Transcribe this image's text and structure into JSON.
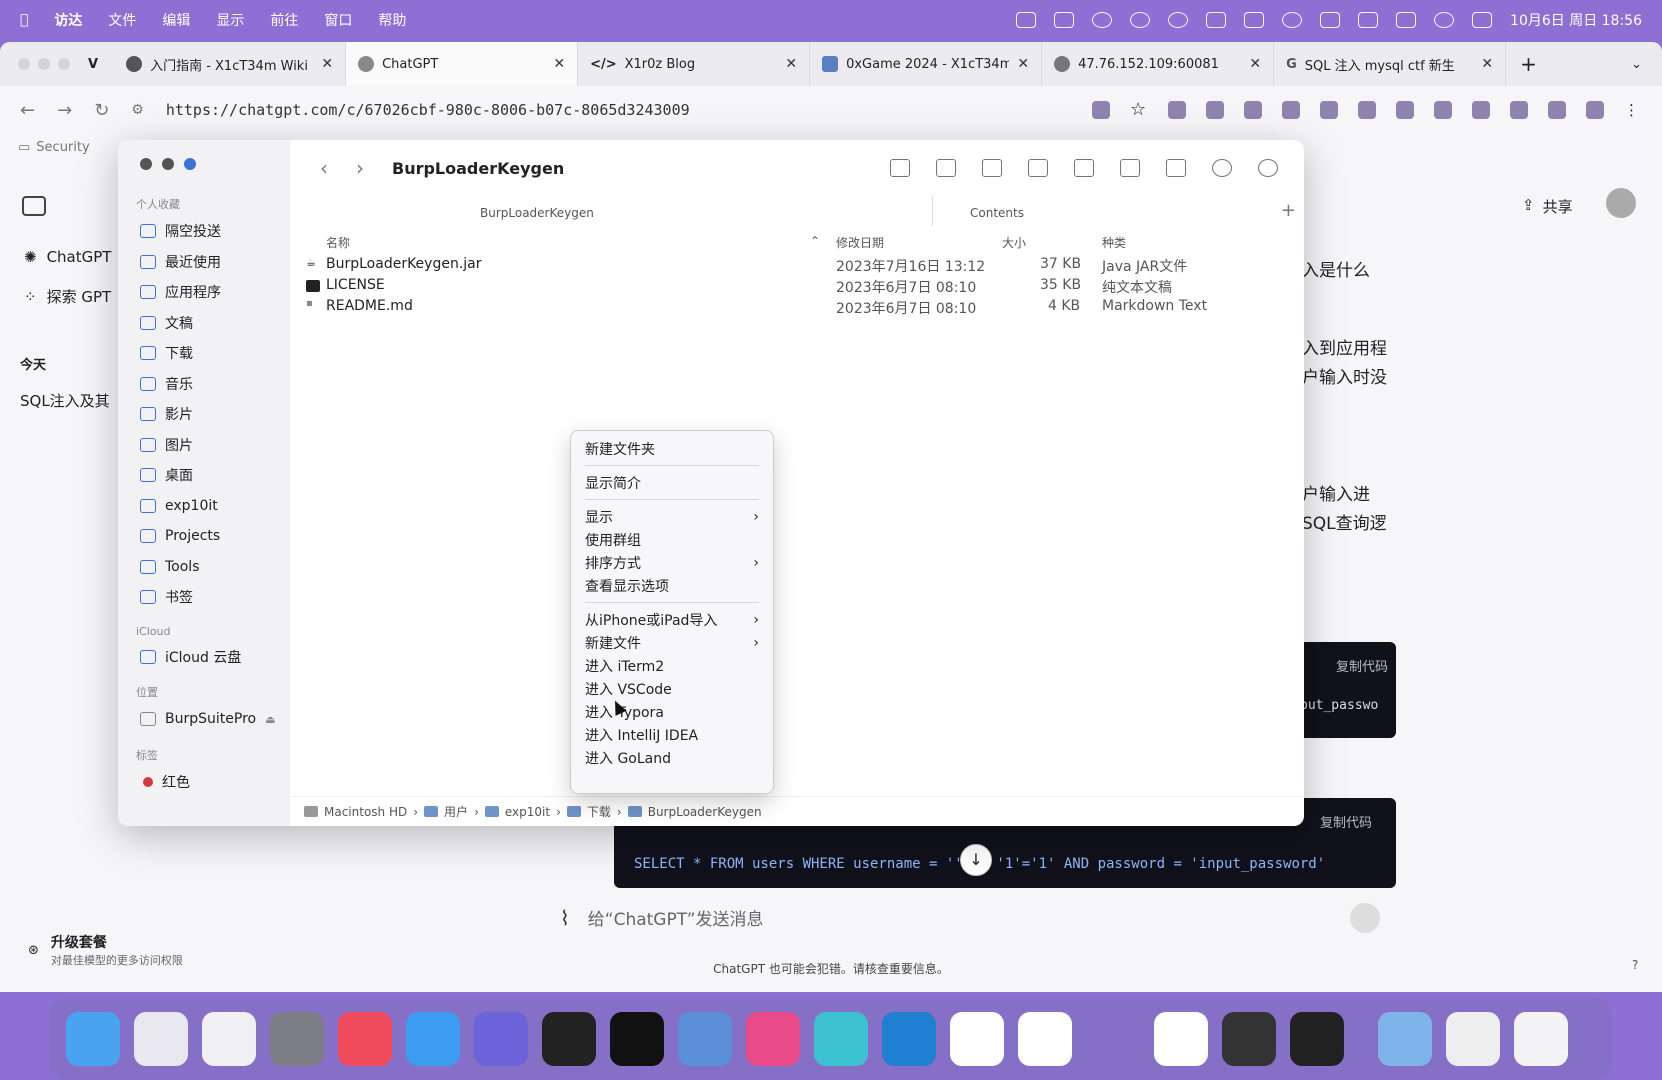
{
  "menubar": {
    "items": [
      "访达",
      "文件",
      "编辑",
      "显示",
      "前往",
      "窗口",
      "帮助"
    ],
    "clock": "10月6日 周日 18:56"
  },
  "browser": {
    "tabs": [
      {
        "title": "入门指南 - X1cT34m Wiki"
      },
      {
        "title": "ChatGPT"
      },
      {
        "title": "X1r0z Blog"
      },
      {
        "title": "0xGame 2024 - X1cT34m"
      },
      {
        "title": "47.76.152.109:60081"
      },
      {
        "title": "SQL 注入 mysql ctf 新生"
      }
    ],
    "url": "https://chatgpt.com/c/67026cbf-980c-8006-b07c-8065d3243009",
    "bookmark": "Security"
  },
  "chatgpt": {
    "sidebar": {
      "chatgpt": "ChatGPT",
      "explore": "探索 GPT",
      "today": "今天",
      "chat_item": "SQL注入及其",
      "upgrade_title": "升级套餐",
      "upgrade_sub": "对最佳模型的更多访问权限"
    },
    "share": "共享",
    "answer_fragments": [
      "入是什么",
      "入到应用程",
      "户输入时没",
      "户输入进",
      "SQL查询逻"
    ],
    "copy_code": "复制代码",
    "code1_fragment": "put_passwo",
    "code2": "SELECT * FROM users WHERE username = '' OR '1'='1' AND password = 'input_password'",
    "composer_placeholder": "给“ChatGPT”发送消息",
    "disclaimer": "ChatGPT 也可能会犯错。请核查重要信息。"
  },
  "finder": {
    "title": "BurpLoaderKeygen",
    "column_left": "BurpLoaderKeygen",
    "column_right": "Contents",
    "sidebar": {
      "favorites_label": "个人收藏",
      "favorites": [
        "隔空投送",
        "最近使用",
        "应用程序",
        "文稿",
        "下载",
        "音乐",
        "影片",
        "图片",
        "桌面",
        "exp10it",
        "Projects",
        "Tools",
        "书签"
      ],
      "icloud_label": "iCloud",
      "icloud": [
        "iCloud 云盘"
      ],
      "locations_label": "位置",
      "locations": [
        "BurpSuitePro"
      ],
      "tags_label": "标签",
      "tags": [
        "红色"
      ]
    },
    "headers": {
      "name": "名称",
      "modified": "修改日期",
      "size": "大小",
      "kind": "种类"
    },
    "files": [
      {
        "name": "BurpLoaderKeygen.jar",
        "modified": "2023年7月16日 13:12",
        "size": "37 KB",
        "kind": "Java JAR文件"
      },
      {
        "name": "LICENSE",
        "modified": "2023年6月7日 08:10",
        "size": "35 KB",
        "kind": "纯文本文稿"
      },
      {
        "name": "README.md",
        "modified": "2023年6月7日 08:10",
        "size": "4 KB",
        "kind": "Markdown Text"
      }
    ],
    "path": [
      "Macintosh HD",
      "用户",
      "exp10it",
      "下载",
      "BurpLoaderKeygen"
    ]
  },
  "context_menu": {
    "groups": [
      [
        {
          "label": "新建文件夹"
        }
      ],
      [
        {
          "label": "显示简介"
        }
      ],
      [
        {
          "label": "显示",
          "sub": true
        },
        {
          "label": "使用群组"
        },
        {
          "label": "排序方式",
          "sub": true
        },
        {
          "label": "查看显示选项"
        }
      ],
      [
        {
          "label": "从iPhone或iPad导入",
          "sub": true
        },
        {
          "label": "新建文件",
          "sub": true
        },
        {
          "label": "进入 iTerm2"
        },
        {
          "label": "进入 VSCode"
        },
        {
          "label": "进入 Typora"
        },
        {
          "label": "进入 IntelliJ IDEA"
        },
        {
          "label": "进入 GoLand"
        }
      ]
    ]
  }
}
